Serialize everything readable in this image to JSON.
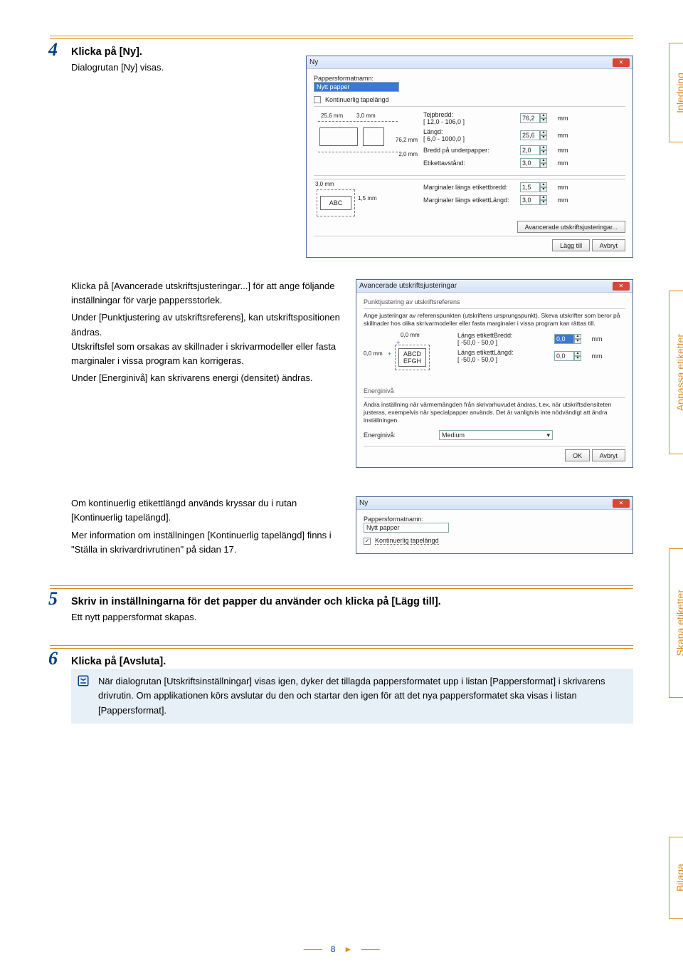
{
  "side_tabs": {
    "inledning": "Inledning",
    "anpassa": "Anpassa etiketter",
    "skapa": "Skapa etiketter",
    "bilaga": "Bilaga"
  },
  "step4": {
    "num": "4",
    "title": "Klicka på [Ny].",
    "sub": "Dialogrutan [Ny] visas."
  },
  "dlg1": {
    "title": "Ny",
    "close": "✕",
    "field_name_label": "Pappersformatnamn:",
    "field_name_value": "Nytt papper",
    "checkbox_label": "Kontinuerlig tapelängd",
    "tape_w": "Tejpbredd:",
    "tape_w_range": "[ 12,0 - 106,0 ]",
    "tape_w_val": "76,2",
    "len": "Längd:",
    "len_range": "[ 6,0 - 1000,0 ]",
    "len_val": "25,6",
    "underpaper": "Bredd på underpapper:",
    "underpaper_val": "2,0",
    "spacing": "Etikettavstånd:",
    "spacing_val": "3,0",
    "m_width": "Marginaler längs etikettbredd:",
    "m_width_val": "1,5",
    "m_len": "Marginaler längs etikettLängd:",
    "m_len_val": "3,0",
    "adv_btn": "Avancerade utskriftsjusteringar...",
    "add_btn": "Lägg till",
    "cancel_btn": "Avbryt",
    "mm": "mm",
    "dim1": "25,6 mm",
    "dim2": "3,0 mm",
    "dim3": "76,2 mm",
    "dim4": "2,0 mm",
    "dim5": "3,0 mm",
    "dim6": "1,5 mm",
    "abc": "ABC"
  },
  "midtext": {
    "p1": "Klicka på [Avancerade utskriftsjusteringar...] för att ange följande inställningar för varje pappersstorlek.",
    "p2": "Under [Punktjustering av utskriftsreferens], kan utskriftspositionen ändras.",
    "p3": "Utskriftsfel som orsakas av skillnader i skrivarmodeller eller fasta marginaler i vissa program kan korrigeras.",
    "p4": "Under [Energinivå] kan skrivarens energi (densitet) ändras."
  },
  "dlg2": {
    "title": "Avancerade utskriftsjusteringar",
    "section1": "Punktjustering av utskriftsreferens",
    "desc": "Ange justeringar av referenspunkten (utskriftens ursprungspunkt). Skeva utskrifter som beror på skillnader hos olika skrivarmodeller eller fasta marginaler i vissa program kan rättas till.",
    "zero_top": "0,0 mm",
    "zero_left": "0,0 mm",
    "sample": "ABCD\nEFGH",
    "lw": "Längs etikettBredd:",
    "lw_range": "[ -50,0 - 50,0 ]",
    "lw_val": "0,0",
    "ll": "Längs etikettLängd:",
    "ll_range": "[ -50,0 - 50,0 ]",
    "ll_val": "0,0",
    "section2": "Energinivå",
    "e_desc": "Ändra inställning när värmemängden från skrivarhuvudet ändras, t.ex. när utskriftsdensiteten justeras, exempelvis när specialpapper används. Det är vanligtvis inte nödvändigt att ändra inställningen.",
    "e_label": "Energinivå:",
    "e_val": "Medium",
    "ok": "OK",
    "cancel": "Avbryt",
    "plus": "+",
    "mm": "mm"
  },
  "midtext2": {
    "p1": "Om kontinuerlig etikettlängd används kryssar du i rutan [Kontinuerlig tapelängd].",
    "p2": "Mer information om inställningen [Kontinuerlig tapelängd] finns i \"Ställa in skrivardrivrutinen\" på sidan 17."
  },
  "dlg3": {
    "title": "Ny",
    "name_label": "Pappersformatnamn:",
    "name_value": "Nytt papper",
    "chk_label": "Kontinuerlig tapelängd"
  },
  "step5": {
    "num": "5",
    "title": "Skriv in inställningarna för det papper du använder och klicka på [Lägg till].",
    "sub": "Ett nytt pappersformat skapas."
  },
  "step6": {
    "num": "6",
    "title": "Klicka på [Avsluta].",
    "tip": "När dialogrutan [Utskriftsinställningar] visas igen, dyker det tillagda pappersformatet upp i listan [Pappersformat] i skrivarens drivrutin. Om applikationen körs avslutar du den och startar den igen för att det nya pappersformatet ska visas i listan [Pappersformat]."
  },
  "footer": {
    "page": "8",
    "tri": "►"
  }
}
